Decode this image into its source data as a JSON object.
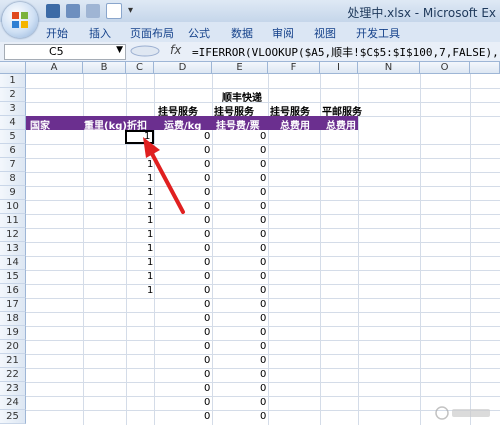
{
  "window": {
    "title": "处理中.xlsx - Microsoft Ex"
  },
  "ribbon": {
    "tabs": [
      "开始",
      "插入",
      "页面布局",
      "公式",
      "数据",
      "审阅",
      "视图",
      "开发工具"
    ]
  },
  "formula_bar": {
    "name_box": "C5",
    "fx": "fx",
    "formula": "=IFERROR(VLOOKUP($A5,顺丰!$C$5:$I$100,7,FALSE),1)"
  },
  "columns": [
    "A",
    "B",
    "C",
    "D",
    "E",
    "F",
    "I",
    "N",
    "O"
  ],
  "rows": [
    "1",
    "2",
    "3",
    "4",
    "5",
    "6",
    "7",
    "8",
    "9",
    "10",
    "11",
    "12",
    "13",
    "14",
    "15",
    "16",
    "17",
    "18",
    "19",
    "20",
    "21",
    "22",
    "23",
    "24",
    "25"
  ],
  "header_rows": {
    "row2_e": "顺丰快递",
    "row3": {
      "d": "挂号服务",
      "e": "挂号服务",
      "f": "挂号服务",
      "i": "平邮服务"
    },
    "row4": {
      "a": "国家",
      "b": "重里(kg)",
      "c": "折扣",
      "d": "运费/kg",
      "e": "挂号费/票",
      "f": "总费用",
      "i": "总费用"
    }
  },
  "data": {
    "c_values": [
      "1",
      "1",
      "1",
      "1",
      "1",
      "1",
      "1",
      "1",
      "1",
      "1",
      "1",
      "1"
    ],
    "d_values": [
      "0",
      "0",
      "0",
      "0",
      "0",
      "0",
      "0",
      "0",
      "0",
      "0",
      "0",
      "0",
      "0",
      "0",
      "0",
      "0",
      "0",
      "0",
      "0",
      "0",
      "0"
    ],
    "e_values": [
      "0",
      "0",
      "0",
      "0",
      "0",
      "0",
      "0",
      "0",
      "0",
      "0",
      "0",
      "0",
      "0",
      "0",
      "0",
      "0",
      "0",
      "0",
      "0",
      "0",
      "0"
    ]
  },
  "colors": {
    "header_band": "#6b2f8f",
    "arrow": "#e02020"
  }
}
